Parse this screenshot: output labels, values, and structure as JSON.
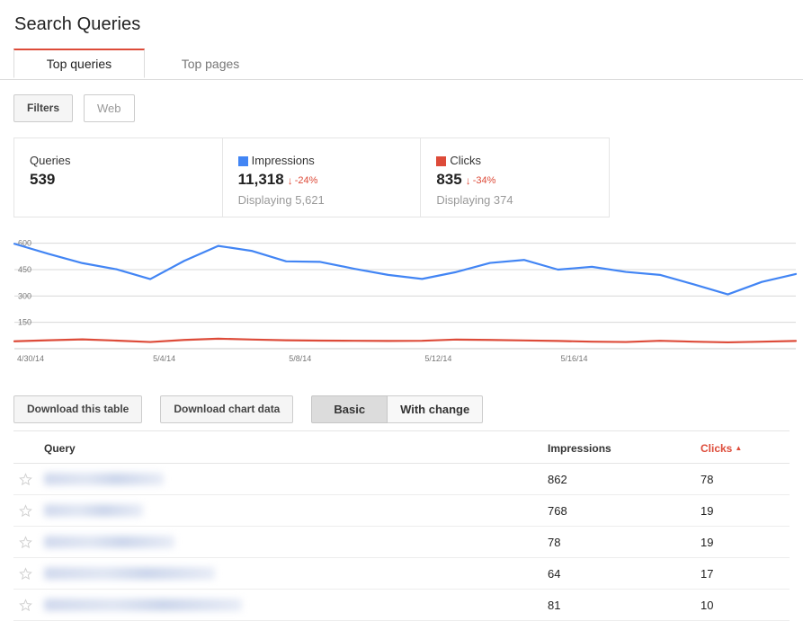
{
  "page": {
    "title": "Search Queries"
  },
  "tabs": [
    {
      "label": "Top queries",
      "active": true
    },
    {
      "label": "Top pages",
      "active": false
    }
  ],
  "filters": {
    "filters_button": "Filters",
    "search_type_button": "Web"
  },
  "summary": {
    "queries": {
      "label": "Queries",
      "value": "539"
    },
    "impressions": {
      "label": "Impressions",
      "value": "11,318",
      "delta": "-24%",
      "delta_arrow": "↓",
      "sub": "Displaying 5,621",
      "color": "#4285f4"
    },
    "clicks": {
      "label": "Clicks",
      "value": "835",
      "delta": "-34%",
      "delta_arrow": "↓",
      "sub": "Displaying 374",
      "color": "#dd4b39"
    }
  },
  "chart_data": {
    "type": "line",
    "title": "",
    "xlabel": "",
    "ylabel": "",
    "ylim": [
      0,
      675
    ],
    "yticks": [
      150,
      300,
      450,
      600
    ],
    "grid": true,
    "legend_position": "summary-cards",
    "x": [
      "4/30/14",
      "5/1/14",
      "5/2/14",
      "5/3/14",
      "5/4/14",
      "5/5/14",
      "5/6/14",
      "5/7/14",
      "5/8/14",
      "5/9/14",
      "5/10/14",
      "5/11/14",
      "5/12/14",
      "5/13/14",
      "5/14/14",
      "5/15/14",
      "5/16/14",
      "5/17/14",
      "5/18/14",
      "5/19/14"
    ],
    "xtick_labels": [
      "4/30/14",
      "5/4/14",
      "5/8/14",
      "5/12/14",
      "5/16/14"
    ],
    "xtick_indices": [
      0,
      4,
      8,
      12,
      16
    ],
    "series": [
      {
        "name": "Impressions",
        "color": "#4285f4",
        "values": [
          597,
          540,
          487,
          452,
          396,
          500,
          585,
          556,
          497,
          494,
          455,
          420,
          397,
          436,
          488,
          505,
          450,
          466,
          437,
          420
        ]
      },
      {
        "name": "Clicks",
        "color": "#dd4b39",
        "values": [
          42,
          48,
          53,
          46,
          38,
          50,
          57,
          52,
          48,
          46,
          45,
          44,
          45,
          52,
          50,
          47,
          44,
          40,
          38,
          45
        ]
      }
    ]
  },
  "chart_data_extra": {
    "impressions_tail": [
      366,
      309,
      380,
      425
    ],
    "clicks_tail": [
      40,
      36,
      40,
      44
    ]
  },
  "actions": {
    "download_table": "Download this table",
    "download_chart": "Download chart data",
    "view_basic": "Basic",
    "view_with_change": "With change"
  },
  "table": {
    "columns": {
      "star": "",
      "query": "Query",
      "impressions": "Impressions",
      "clicks": "Clicks"
    },
    "sorted_column": "clicks",
    "sort_direction": "▲",
    "rows": [
      {
        "query": "",
        "redacted_width": 133,
        "impressions": "862",
        "clicks": "78"
      },
      {
        "query": "",
        "redacted_width": 110,
        "impressions": "768",
        "clicks": "19"
      },
      {
        "query": "",
        "redacted_width": 145,
        "impressions": "78",
        "clicks": "19"
      },
      {
        "query": "",
        "redacted_width": 190,
        "impressions": "64",
        "clicks": "17"
      },
      {
        "query": "",
        "redacted_width": 220,
        "impressions": "81",
        "clicks": "10"
      }
    ]
  }
}
